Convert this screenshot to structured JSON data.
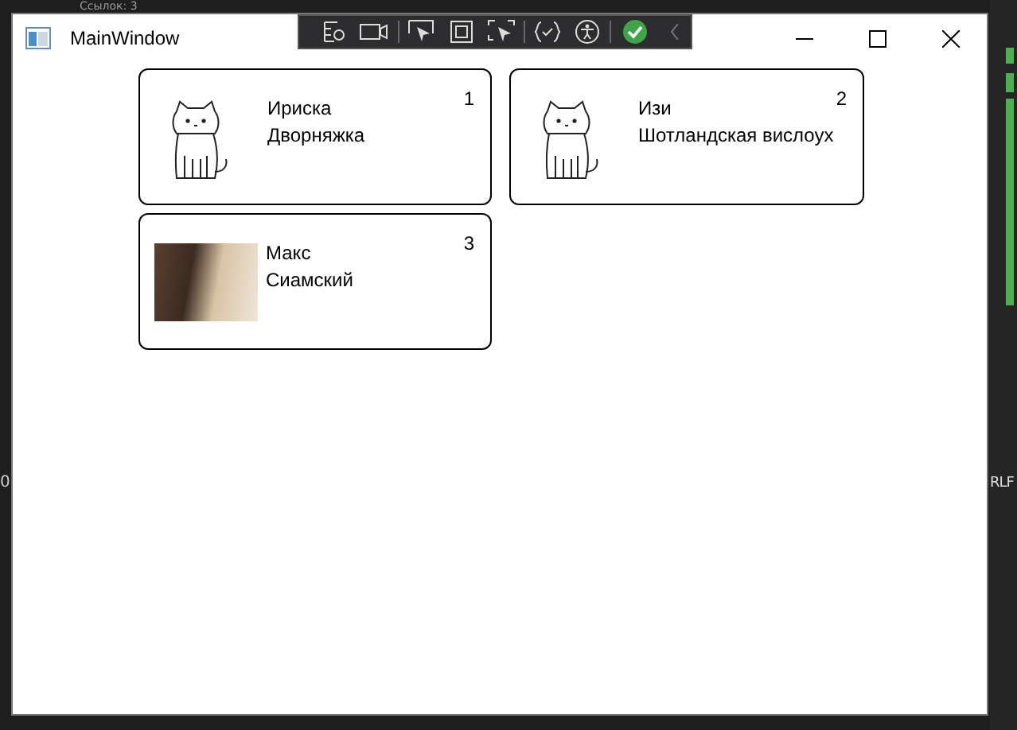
{
  "background": {
    "texts": [
      {
        "kind": "refs",
        "text": "Ссылок: 3"
      },
      {
        "kind": "left",
        "text": "0"
      },
      {
        "kind": "right",
        "text": "RLF"
      }
    ]
  },
  "window": {
    "title": "MainWindow"
  },
  "cards": [
    {
      "name": "Ириска",
      "breed": "Дворняжка",
      "number": "1",
      "kind": "sketch"
    },
    {
      "name": "Изи",
      "breed": "Шотландская вислоух",
      "number": "2",
      "kind": "sketch"
    },
    {
      "name": "Макс",
      "breed": "Сиамский",
      "number": "3",
      "kind": "photo"
    }
  ]
}
